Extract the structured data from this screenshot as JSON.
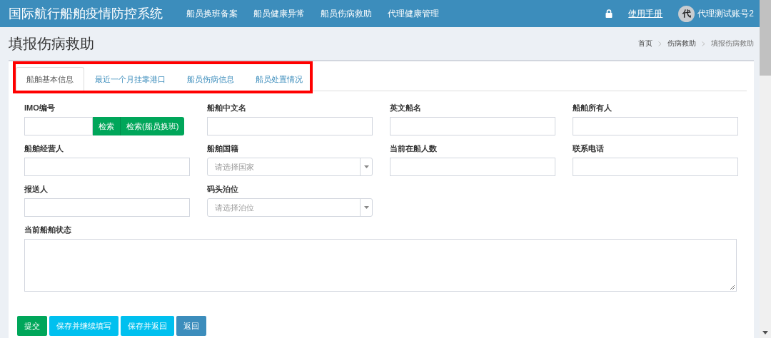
{
  "app_title": "国际航行船舶疫情防控系统",
  "nav": [
    {
      "label": "船员换班备案",
      "selected": false
    },
    {
      "label": "船员健康异常",
      "selected": false
    },
    {
      "label": "船员伤病救助",
      "selected": false
    },
    {
      "label": "代理健康管理",
      "selected": false
    }
  ],
  "manual_link": "使用手册",
  "user": {
    "avatar": "代",
    "name": "代理测试账号2"
  },
  "page_title": "填报伤病救助",
  "breadcrumb": [
    "首页",
    "伤病救助",
    "填报伤病救助"
  ],
  "tabs": [
    {
      "label": "船舶基本信息",
      "selected": true
    },
    {
      "label": "最近一个月挂靠港口",
      "selected": false
    },
    {
      "label": "船员伤病信息",
      "selected": false
    },
    {
      "label": "船员处置情况",
      "selected": false
    }
  ],
  "fields": [
    {
      "kind": "search",
      "label": "IMO编号",
      "buttons": [
        "检索",
        "检索(船员换班)"
      ]
    },
    {
      "kind": "text",
      "label": "船舶中文名"
    },
    {
      "kind": "text",
      "label": "英文船名"
    },
    {
      "kind": "text",
      "label": "船舶所有人"
    },
    {
      "kind": "text",
      "label": "船舶经营人"
    },
    {
      "kind": "select",
      "label": "船舶国籍",
      "placeholder": "请选择国家"
    },
    {
      "kind": "text",
      "label": "当前在船人数"
    },
    {
      "kind": "text",
      "label": "联系电话"
    },
    {
      "kind": "text",
      "label": "报送人"
    },
    {
      "kind": "select",
      "label": "码头泊位",
      "placeholder": "请选择泊位"
    },
    {
      "kind": "textarea",
      "label": "当前船舶状态"
    }
  ],
  "actions": [
    {
      "label": "提交",
      "color": "#00a65a"
    },
    {
      "label": "保存并继续填写",
      "color": "#00c0ef"
    },
    {
      "label": "保存并返回",
      "color": "#00c0ef"
    },
    {
      "label": "返回",
      "color": "#3c8dbc"
    }
  ]
}
